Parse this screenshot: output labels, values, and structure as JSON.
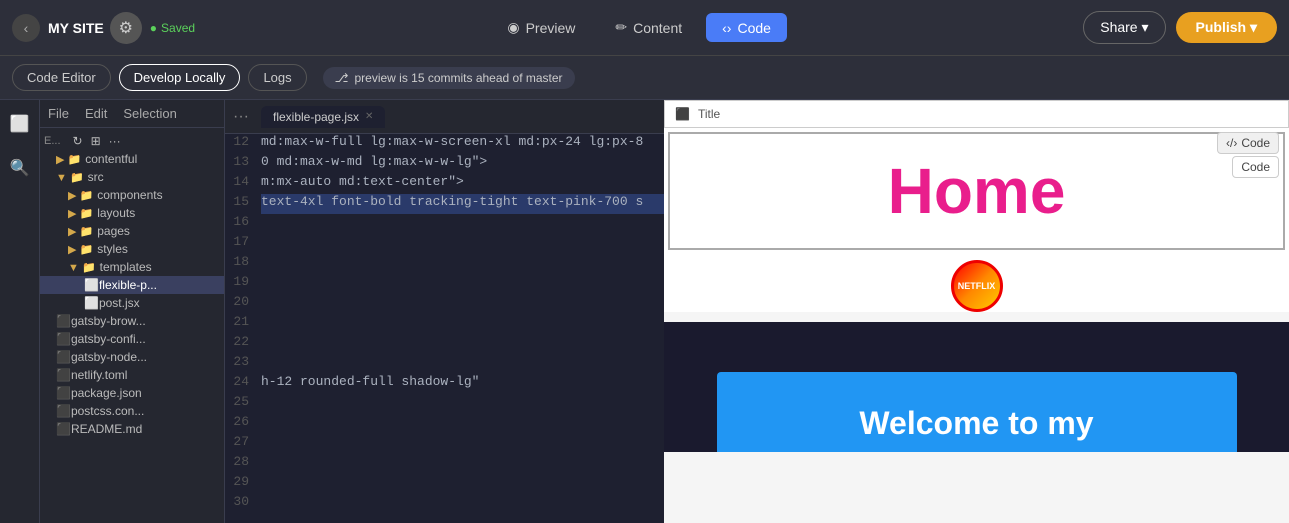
{
  "site": {
    "name": "MY SITE",
    "status": "Saved"
  },
  "nav": {
    "back_label": "‹",
    "settings_icon": "⚙",
    "tabs": [
      {
        "id": "preview",
        "label": "Preview",
        "icon": "◉"
      },
      {
        "id": "content",
        "label": "Content",
        "icon": "✏"
      },
      {
        "id": "code",
        "label": "Code",
        "icon": "‹›",
        "active": true
      }
    ],
    "share_label": "Share ▾",
    "publish_label": "Publish ▾"
  },
  "toolbar": {
    "buttons": [
      {
        "id": "code-editor",
        "label": "Code Editor",
        "active": false
      },
      {
        "id": "develop-locally",
        "label": "Develop Locally",
        "active": true
      },
      {
        "id": "logs",
        "label": "Logs",
        "active": false
      }
    ],
    "git_status": "preview is 15 commits ahead of master"
  },
  "menu_bar": {
    "items": [
      "File",
      "Edit",
      "Selection"
    ]
  },
  "file_tree": {
    "items": [
      {
        "id": "e-icon",
        "label": "E...",
        "type": "icon",
        "indent": 0
      },
      {
        "id": "contentful",
        "label": "contentful",
        "type": "folder",
        "indent": 1
      },
      {
        "id": "src",
        "label": "src",
        "type": "folder",
        "indent": 1,
        "open": true
      },
      {
        "id": "components",
        "label": "components",
        "type": "folder",
        "indent": 2
      },
      {
        "id": "layouts",
        "label": "layouts",
        "type": "folder",
        "indent": 2
      },
      {
        "id": "pages",
        "label": "pages",
        "type": "folder",
        "indent": 2
      },
      {
        "id": "styles",
        "label": "styles",
        "type": "folder",
        "indent": 2
      },
      {
        "id": "templates",
        "label": "templates",
        "type": "folder",
        "indent": 2,
        "open": true
      },
      {
        "id": "flexible-p",
        "label": "flexible-p...",
        "type": "file-jsx",
        "indent": 3,
        "selected": true
      },
      {
        "id": "post-jsx",
        "label": "post.jsx",
        "type": "file-jsx",
        "indent": 3
      },
      {
        "id": "gatsby-brow",
        "label": "gatsby-brow...",
        "type": "file-js",
        "indent": 1
      },
      {
        "id": "gatsby-conf",
        "label": "gatsby-confi...",
        "type": "file-js",
        "indent": 1
      },
      {
        "id": "gatsby-node",
        "label": "gatsby-node...",
        "type": "file-js",
        "indent": 1
      },
      {
        "id": "netlify-toml",
        "label": "netlify.toml",
        "type": "file-toml",
        "indent": 1
      },
      {
        "id": "package-json",
        "label": "package.json",
        "type": "file-json",
        "indent": 1
      },
      {
        "id": "postcss-con",
        "label": "postcss.con...",
        "type": "file-css",
        "indent": 1
      },
      {
        "id": "readme-md",
        "label": "README.md",
        "type": "file-md",
        "indent": 1
      }
    ]
  },
  "editor": {
    "tab_label": "flexible-page.jsx",
    "lines": [
      {
        "num": 12,
        "code": "md:max-w-full lg:max-w-screen-xl md:px-24 lg:px-8"
      },
      {
        "num": 13,
        "code": "0 md:max-w-md lg:max-w-w-lg\">"
      },
      {
        "num": 14,
        "code": "m:mx-auto md:text-center\">"
      },
      {
        "num": 15,
        "code": "text-4xl font-bold tracking-tight text-pink-700 s",
        "highlight": true
      },
      {
        "num": 16,
        "code": ""
      },
      {
        "num": 17,
        "code": ""
      },
      {
        "num": 18,
        "code": ""
      },
      {
        "num": 19,
        "code": ""
      },
      {
        "num": 20,
        "code": ""
      },
      {
        "num": 21,
        "code": ""
      },
      {
        "num": 22,
        "code": ""
      },
      {
        "num": 23,
        "code": ""
      },
      {
        "num": 24,
        "code": "h-12 rounded-full shadow-lg\""
      },
      {
        "num": 25,
        "code": ""
      },
      {
        "num": 26,
        "code": ""
      },
      {
        "num": 27,
        "code": ""
      },
      {
        "num": 28,
        "code": ""
      },
      {
        "num": 29,
        "code": ""
      },
      {
        "num": 30,
        "code": ""
      }
    ]
  },
  "preview": {
    "title_label": "Title",
    "home_text": "Home",
    "code_btn1": "⟨/⟩ Code",
    "code_btn2": "Code",
    "netflix_text": "NETFLIX",
    "welcome_text": "Welcome to my"
  }
}
